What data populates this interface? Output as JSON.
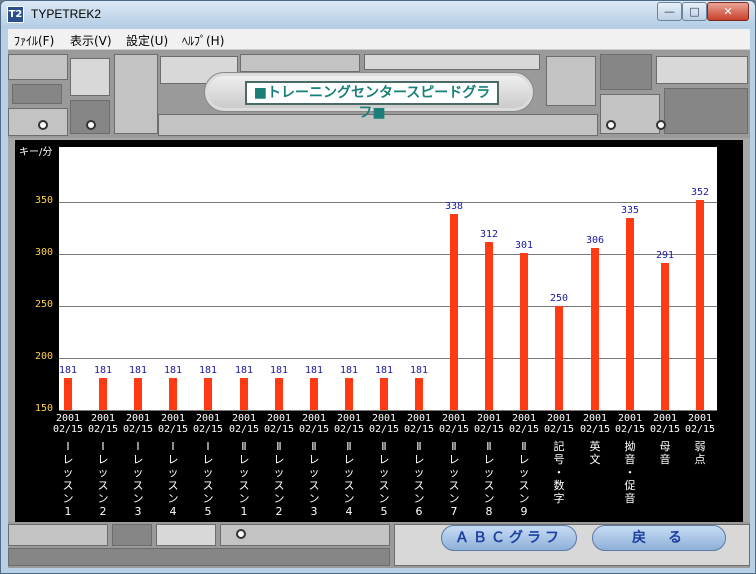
{
  "window": {
    "title": "TYPETREK2",
    "icon_text": "T2"
  },
  "menubar": {
    "items": [
      "ﾌｧｲﾙ(F)",
      "表示(V)",
      "設定(U)",
      "ﾍﾙﾌﾟ(H)"
    ]
  },
  "banner": {
    "label": "■トレーニングセンタースピードグラフ■"
  },
  "chart_data": {
    "type": "bar",
    "ylabel": "キー/分",
    "ylim": [
      150,
      380
    ],
    "yticks": [
      150,
      200,
      250,
      300,
      350
    ],
    "x_dates": [
      "2001\n02/15",
      "2001\n02/15",
      "2001\n02/15",
      "2001\n02/15",
      "2001\n02/15",
      "2001\n02/15",
      "2001\n02/15",
      "2001\n02/15",
      "2001\n02/15",
      "2001\n02/15",
      "2001\n02/15",
      "2001\n02/15",
      "2001\n02/15",
      "2001\n02/15",
      "2001\n02/15",
      "2001\n02/15",
      "2001\n02/15",
      "2001\n02/15",
      "2001\n02/15"
    ],
    "categories": [
      "Ⅰ\nレ\nッ\nス\nン\n1",
      "Ⅰ\nレ\nッ\nス\nン\n2",
      "Ⅰ\nレ\nッ\nス\nン\n3",
      "Ⅰ\nレ\nッ\nス\nン\n4",
      "Ⅰ\nレ\nッ\nス\nン\n5",
      "Ⅱ\nレ\nッ\nス\nン\n1",
      "Ⅱ\nレ\nッ\nス\nン\n2",
      "Ⅱ\nレ\nッ\nス\nン\n3",
      "Ⅱ\nレ\nッ\nス\nン\n4",
      "Ⅱ\nレ\nッ\nス\nン\n5",
      "Ⅱ\nレ\nッ\nス\nン\n6",
      "Ⅱ\nレ\nッ\nス\nン\n7",
      "Ⅱ\nレ\nッ\nス\nン\n8",
      "Ⅱ\nレ\nッ\nス\nン\n9",
      "記\n号\n・\n数\n字",
      "英\n文",
      "拗\n音\n・\n促\n音",
      "母\n音",
      "弱\n点"
    ],
    "values": [
      181,
      181,
      181,
      181,
      181,
      181,
      181,
      181,
      181,
      181,
      181,
      338,
      312,
      301,
      250,
      306,
      335,
      291,
      352
    ],
    "bar_color": "#ff3b16",
    "grid": true
  },
  "buttons": {
    "abc_graph": "ＡＢＣグラフ",
    "back": "戻　る"
  },
  "colors": {
    "banner_text": "#197f78",
    "ytick": "#ffd24a",
    "value_label": "#1a1aa0"
  }
}
